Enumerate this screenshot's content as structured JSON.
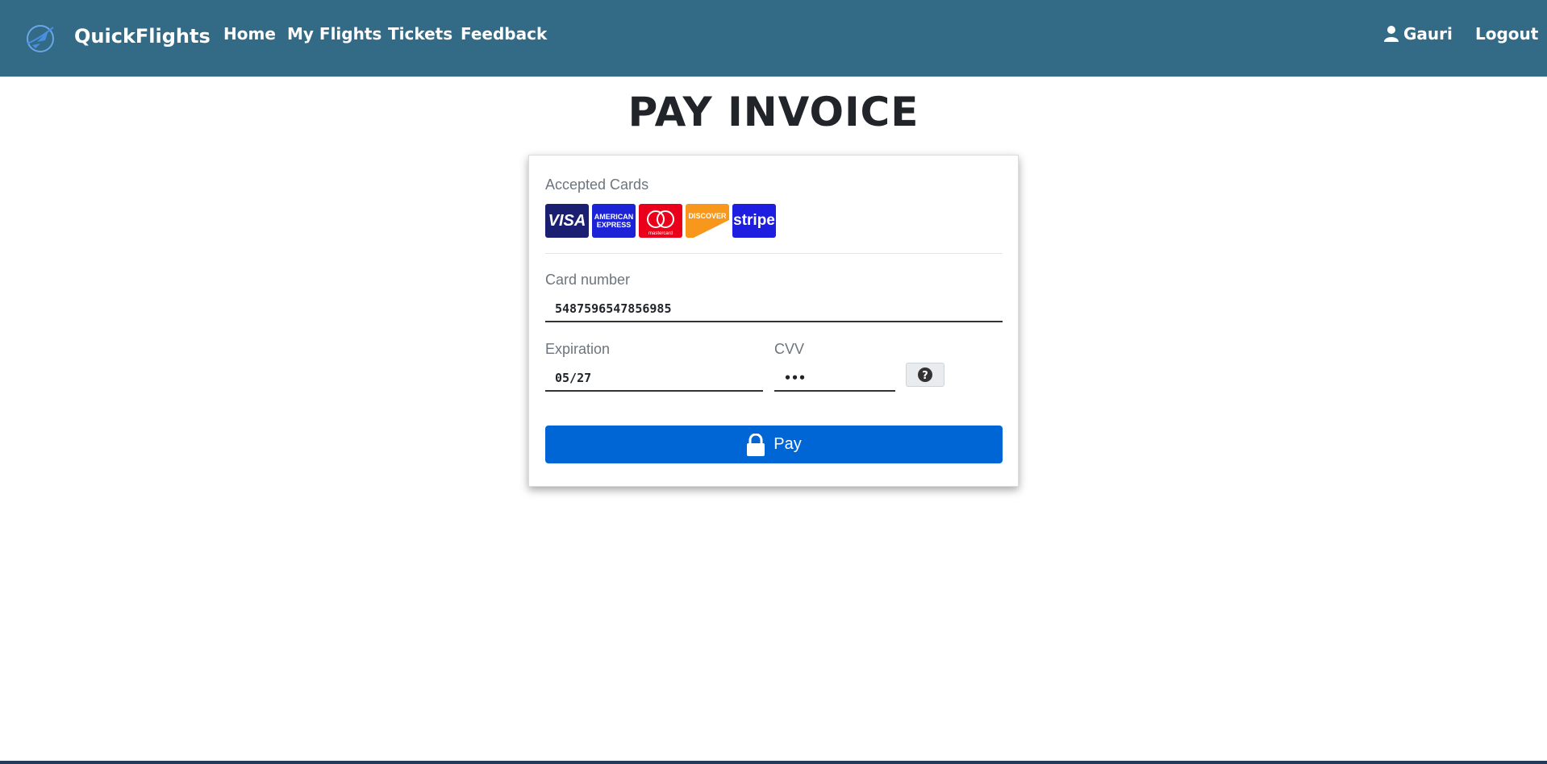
{
  "nav": {
    "brand": "QuickFlights",
    "links": [
      "Home",
      "My Flights",
      "Tickets",
      "Feedback"
    ],
    "user": "Gauri",
    "logout": "Logout",
    "bg_color": "#336b87"
  },
  "page": {
    "title": "PAY INVOICE"
  },
  "payment": {
    "accepted_label": "Accepted Cards",
    "cards": [
      {
        "name": "visa-icon",
        "text": "VISA"
      },
      {
        "name": "amex-icon",
        "text": "AMERICAN EXPRESS"
      },
      {
        "name": "mastercard-icon",
        "text": "mastercard"
      },
      {
        "name": "discover-icon",
        "text": "DISCOVER"
      },
      {
        "name": "stripe-icon",
        "text": "stripe"
      }
    ],
    "card_number_label": "Card number",
    "card_number_value": "5487596547856985",
    "expiration_label": "Expiration",
    "expiration_value": "05/27",
    "cvv_label": "CVV",
    "cvv_value": "•••",
    "pay_label": "Pay",
    "pay_color": "#0066d6"
  }
}
